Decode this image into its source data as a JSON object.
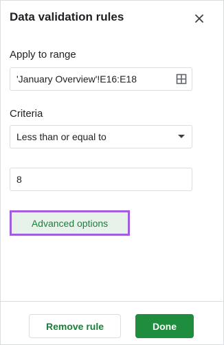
{
  "panel": {
    "title": "Data validation rules",
    "close_icon": "close-icon"
  },
  "range": {
    "label": "Apply to range",
    "value": "'January Overview'!E16:E18",
    "icon": "grid-select-icon"
  },
  "criteria": {
    "label": "Criteria",
    "selected": "Less than or equal to",
    "dropdown_icon": "caret-down-icon",
    "value": "8"
  },
  "advanced": {
    "label": "Advanced options"
  },
  "footer": {
    "remove_label": "Remove rule",
    "done_label": "Done"
  },
  "colors": {
    "accent_green": "#188038",
    "done_bg": "#1e8e3e",
    "highlight_border": "#a15ddb",
    "advanced_bg": "#e7f3ea"
  }
}
